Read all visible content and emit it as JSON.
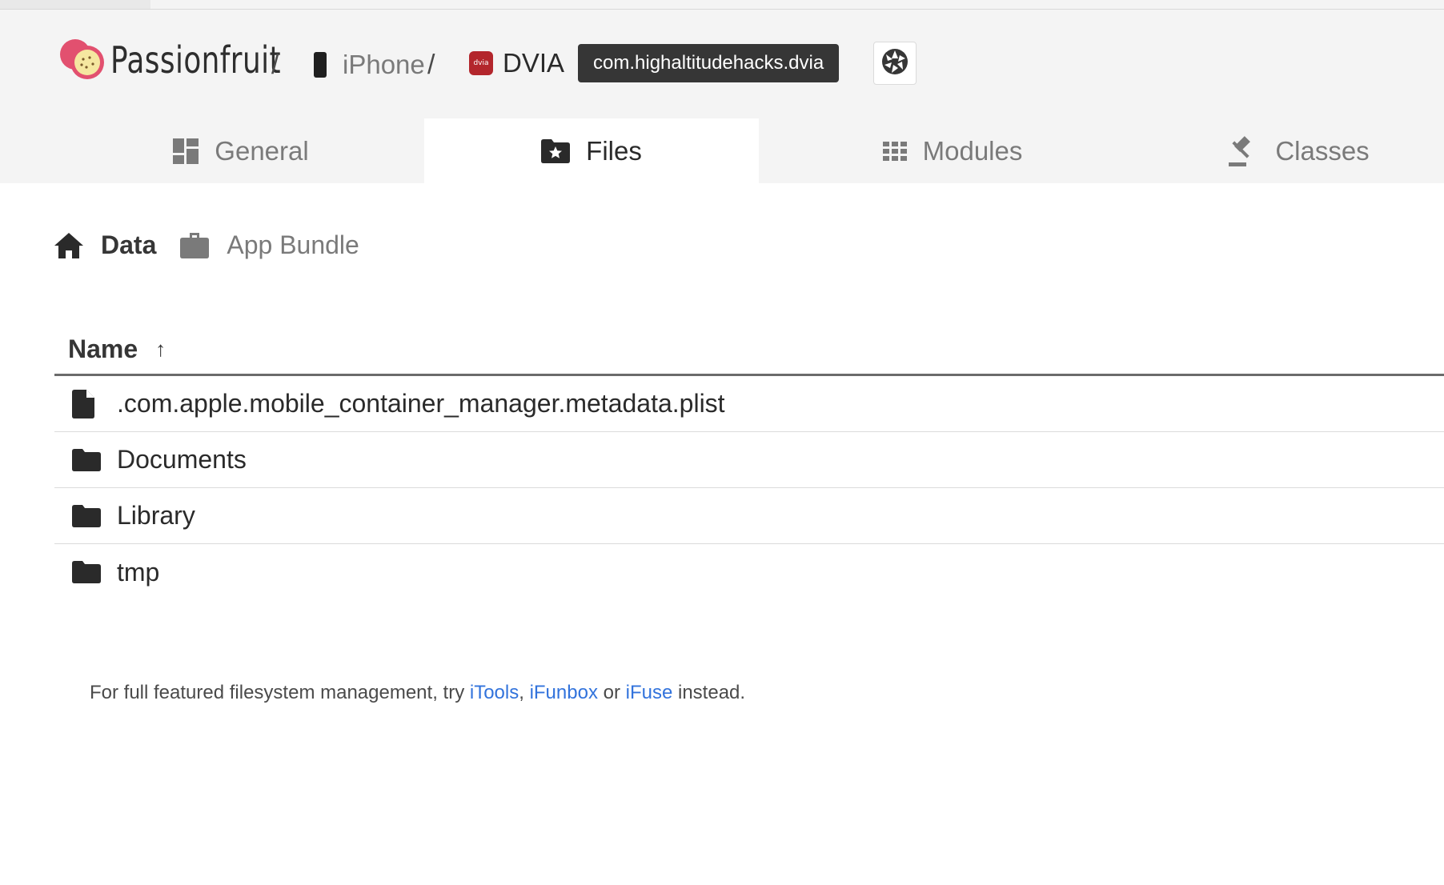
{
  "header": {
    "brand": "Passionfruit",
    "separator": "/",
    "device": "iPhone",
    "app_name": "DVIA",
    "app_icon_text": "dvia",
    "bundle_id": "com.highaltitudehacks.dvia"
  },
  "tabs": [
    {
      "label": "General",
      "icon": "dashboard-icon"
    },
    {
      "label": "Files",
      "icon": "folder-star-icon",
      "active": true
    },
    {
      "label": "Modules",
      "icon": "grid-icon"
    },
    {
      "label": "Classes",
      "icon": "gavel-icon"
    }
  ],
  "subtabs": [
    {
      "label": "Data",
      "icon": "home-icon",
      "active": true
    },
    {
      "label": "App Bundle",
      "icon": "briefcase-icon"
    }
  ],
  "table": {
    "column": "Name",
    "sort_indicator": "↑",
    "rows": [
      {
        "name": ".com.apple.mobile_container_manager.metadata.plist",
        "type": "file"
      },
      {
        "name": "Documents",
        "type": "folder"
      },
      {
        "name": "Library",
        "type": "folder"
      },
      {
        "name": "tmp",
        "type": "folder"
      }
    ]
  },
  "footer": {
    "prefix": "For full featured filesystem management, try ",
    "link1": "iTools",
    "comma": ",",
    "link2": "iFunbox",
    "or": " or ",
    "link3": "iFuse",
    "suffix": " instead."
  },
  "colors": {
    "header_bg": "#f4f4f4",
    "tag_bg": "#363636",
    "link": "#3273dc",
    "app_icon": "#b3262c"
  }
}
